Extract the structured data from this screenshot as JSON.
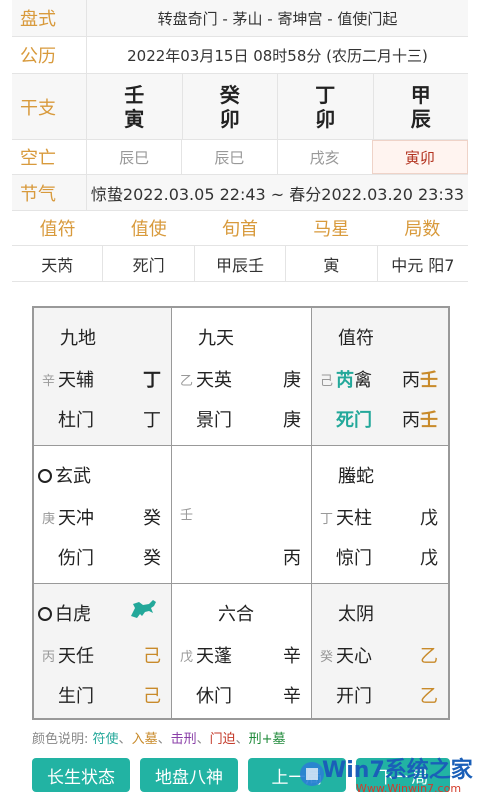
{
  "info": {
    "pan_label": "盘式",
    "pan_value": "转盘奇门 - 茅山 - 寄坤宫 - 值使门起",
    "date_label": "公历",
    "date_value": "2022年03月15日 08时58分 (农历二月十三)",
    "ganzhi_label": "干支",
    "ganzhi": [
      {
        "top": "壬",
        "bottom": "寅"
      },
      {
        "top": "癸",
        "bottom": "卯"
      },
      {
        "top": "丁",
        "bottom": "卯"
      },
      {
        "top": "甲",
        "bottom": "辰"
      }
    ],
    "kongwang_label": "空亡",
    "kongwang": [
      "辰巳",
      "辰巳",
      "戌亥",
      "寅卯"
    ],
    "jieqi_label": "节气",
    "jieqi_value": "惊蛰2022.03.05 22:43 ~ 春分2022.03.20 23:33",
    "headers": [
      "值符",
      "值使",
      "旬首",
      "马星",
      "局数"
    ],
    "values": [
      "天芮",
      "死门",
      "甲辰壬",
      "寅",
      "中元 阳7"
    ]
  },
  "palaces": [
    {
      "god": "九地",
      "stem_small": "辛",
      "star": "天辅",
      "star_gan": "丁",
      "door": "杜门",
      "door_gan": "丁"
    },
    {
      "god": "九天",
      "stem_small": "乙",
      "star": "天英",
      "star_gan": "庚",
      "door": "景门",
      "door_gan": "庚"
    },
    {
      "god": "值符",
      "stem_small": "己",
      "star_a": "芮",
      "star_b": "禽",
      "star_gan": "丙壬",
      "door": "死门",
      "door_gan": "丙壬"
    },
    {
      "god": "玄武",
      "stem_small": "庚",
      "star": "天冲",
      "star_gan": "癸",
      "door": "伤门",
      "door_gan": "癸"
    },
    {
      "center_small": "壬",
      "center_gan": "丙"
    },
    {
      "god": "螣蛇",
      "stem_small": "丁",
      "star": "天柱",
      "star_gan": "戊",
      "door": "惊门",
      "door_gan": "戊"
    },
    {
      "god": "白虎",
      "stem_small": "丙",
      "star": "天任",
      "star_gan": "己",
      "door": "生门",
      "door_gan": "己"
    },
    {
      "god": "六合",
      "stem_small": "戊",
      "star": "天蓬",
      "star_gan": "辛",
      "door": "休门",
      "door_gan": "辛"
    },
    {
      "god": "太阴",
      "stem_small": "癸",
      "star": "天心",
      "star_gan": "乙",
      "door": "开门",
      "door_gan": "乙"
    }
  ],
  "legend": {
    "prefix": "颜色说明:",
    "items": [
      "符使",
      "入墓",
      "击刑",
      "门迫",
      "刑+墓"
    ],
    "colors": [
      "#23a89a",
      "#c88a2a",
      "#8a3fa8",
      "#c43a2a",
      "#1f8a3a"
    ]
  },
  "buttons": [
    "长生状态",
    "地盘八神",
    "上一局",
    "下一局"
  ],
  "watermark": {
    "text": "Win7系统之家",
    "url": "Www.Winwin7.com"
  }
}
